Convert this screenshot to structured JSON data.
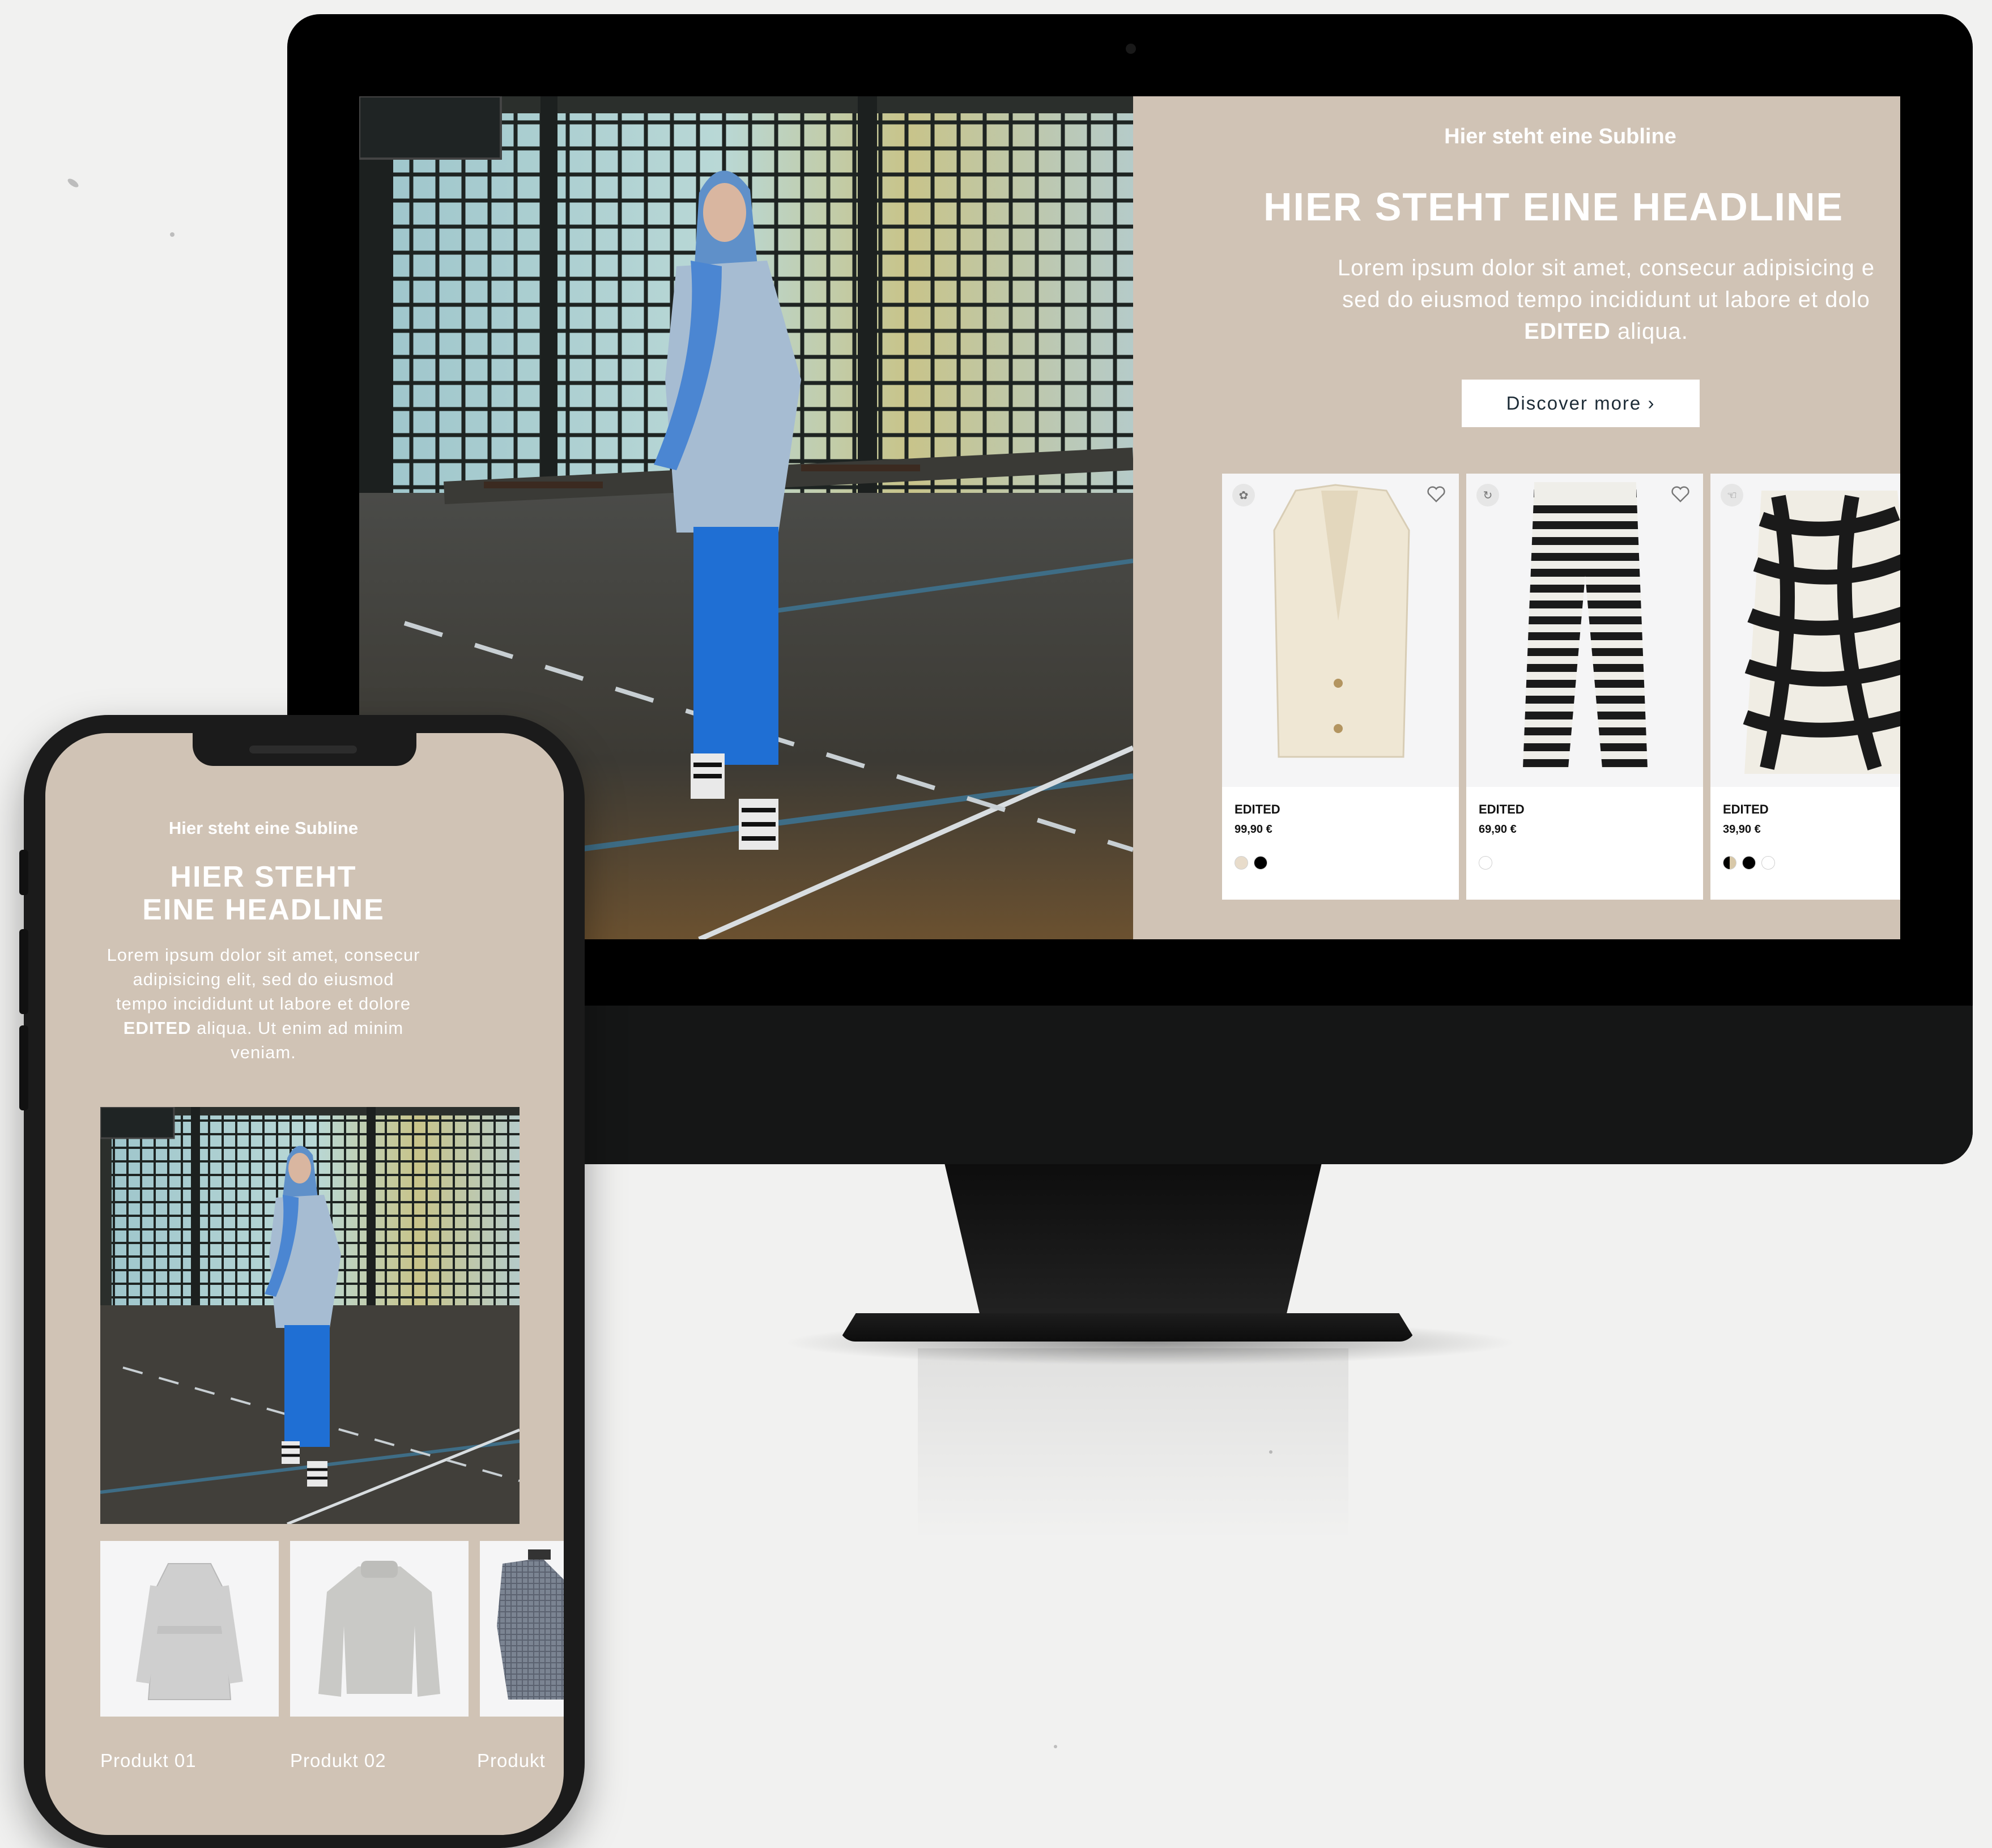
{
  "colors": {
    "panel_bg": "#d0c3b5",
    "cta_text": "#1c2b36",
    "device_black": "#000000"
  },
  "desktop": {
    "subline": "Hier steht eine Subline",
    "headline": "HIER STEHT EINE HEADLINE",
    "body_line1": "Lorem ipsum dolor sit amet, consecur adipisicing e",
    "body_line2": "sed do eiusmod tempo incididunt ut labore et dolo",
    "body_bold": "EDITED",
    "body_end": " aliqua.",
    "cta_label": "Discover more ›",
    "products": [
      {
        "brand": "EDITED",
        "price": "99,90 €",
        "badge_icon": "plant-icon",
        "image": "cream-vest",
        "swatches": [
          "#e8dccb",
          "#000000"
        ]
      },
      {
        "brand": "EDITED",
        "price": "69,90 €",
        "badge_icon": "recycle-icon",
        "image": "striped-pants",
        "swatches": [
          "#ffffff"
        ]
      },
      {
        "brand": "EDITED",
        "price": "39,90 €",
        "badge_icon": "hand-icon",
        "image": "zebra-top",
        "swatches": [
          "#d8c8a8",
          "#000000",
          "#ffffff"
        ]
      }
    ]
  },
  "mobile": {
    "subline": "Hier steht eine Subline",
    "headline_line1": "HIER STEHT",
    "headline_line2": "EINE HEADLINE",
    "body_text": "Lorem ipsum dolor sit amet, consecur adipisicing elit, sed do eiusmod tempo incididunt ut labore et dolore ",
    "body_bold": "EDITED",
    "body_end": " aliqua. Ut enim ad minim veniam.",
    "products": [
      {
        "label": "Produkt 01",
        "image": "grey-coat"
      },
      {
        "label": "Produkt 02",
        "image": "grey-sweater"
      },
      {
        "label": "Produkt",
        "image": "check-blazer"
      }
    ]
  }
}
